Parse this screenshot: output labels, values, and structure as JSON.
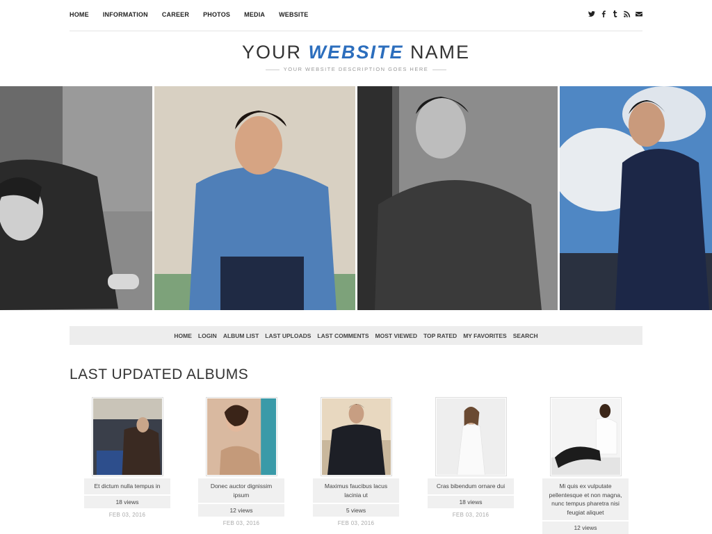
{
  "topnav": {
    "items": [
      "HOME",
      "INFORMATION",
      "CAREER",
      "PHOTOS",
      "MEDIA",
      "WEBSITE"
    ]
  },
  "social": {
    "icons": [
      "twitter-icon",
      "facebook-icon",
      "tumblr-icon",
      "rss-icon",
      "email-icon"
    ]
  },
  "header": {
    "title_prefix": "YOUR",
    "title_accent": "WEBSITE",
    "title_suffix": "NAME",
    "description": "YOUR WEBSITE DESCRIPTION GOES HERE",
    "accent_color": "#2c6ebd"
  },
  "subnav": {
    "items": [
      "HOME",
      "LOGIN",
      "ALBUM LIST",
      "LAST UPLOADS",
      "LAST COMMENTS",
      "MOST VIEWED",
      "TOP RATED",
      "MY FAVORITES",
      "SEARCH"
    ]
  },
  "albums": {
    "section_title": "LAST UPDATED ALBUMS",
    "items": [
      {
        "title": "Et dictum nulla tempus in",
        "views": "18 views",
        "date": "FEB 03, 2016"
      },
      {
        "title": "Donec auctor dignissim ipsum",
        "views": "12 views",
        "date": "FEB 03, 2016"
      },
      {
        "title": "Maximus faucibus lacus lacinia ut",
        "views": "5 views",
        "date": "FEB 03, 2016"
      },
      {
        "title": "Cras bibendum ornare dui",
        "views": "18 views",
        "date": "FEB 03, 2016"
      },
      {
        "title": "Mi quis ex vulputate pellentesque et non magna, nunc tempus pharetra nisi feugiat aliquet",
        "views": "12 views",
        "date": ""
      }
    ]
  }
}
